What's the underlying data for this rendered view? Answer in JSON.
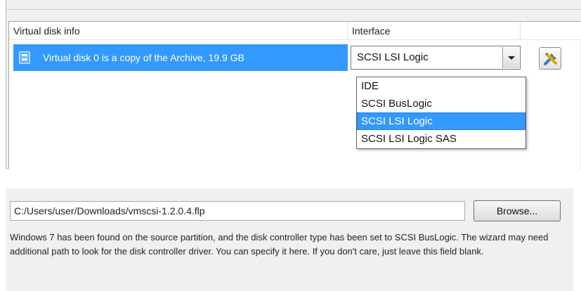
{
  "disk_table": {
    "headers": {
      "info": "Virtual disk info",
      "interface": "Interface"
    },
    "rows": [
      {
        "text": "Virtual disk 0 is a copy of the Archive, 19.9 GB",
        "interface": "SCSI LSI Logic"
      }
    ]
  },
  "interface_dropdown": {
    "selected": "SCSI LSI Logic",
    "options": [
      "IDE",
      "SCSI BusLogic",
      "SCSI LSI Logic",
      "SCSI LSI Logic SAS"
    ]
  },
  "icons": {
    "row": "virtual-disk-icon",
    "settings": "tools-icon",
    "dropdown": "chevron-down-icon"
  },
  "driver": {
    "path_value": "C:/Users/user/Downloads/vmscsi-1.2.0.4.flp",
    "browse_label": "Browse...",
    "info_text": "Windows 7 has been found on the source partition, and the disk controller type has been set to SCSI BusLogic. The wizard may need additional path to look for the disk controller driver. You can specify it here. If you don't care, just leave this field blank."
  },
  "colors": {
    "selection": "#3399ff",
    "panel": "#f0f0f0"
  }
}
